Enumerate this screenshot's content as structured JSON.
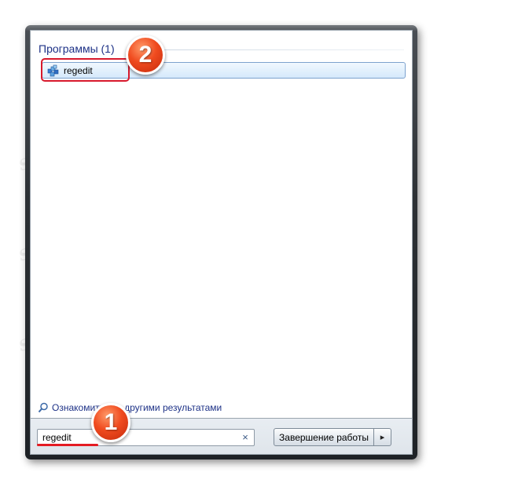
{
  "section": {
    "title": "Программы (1)"
  },
  "results": [
    {
      "label": "regedit",
      "icon": "regedit-icon"
    }
  ],
  "see_more": {
    "label": "Ознакомиться с другими результатами",
    "icon": "search-icon"
  },
  "search": {
    "value": "regedit",
    "clear_symbol": "×"
  },
  "shutdown": {
    "label": "Завершение работы",
    "arrow": "▸"
  },
  "annotations": {
    "badge_1": "1",
    "badge_2": "2"
  },
  "watermark": {
    "text": "Soringpcrepair.com"
  },
  "colors": {
    "accent_title": "#1e3287",
    "annotation_red": "#e41b22",
    "badge_orange": "#f04b1f"
  }
}
